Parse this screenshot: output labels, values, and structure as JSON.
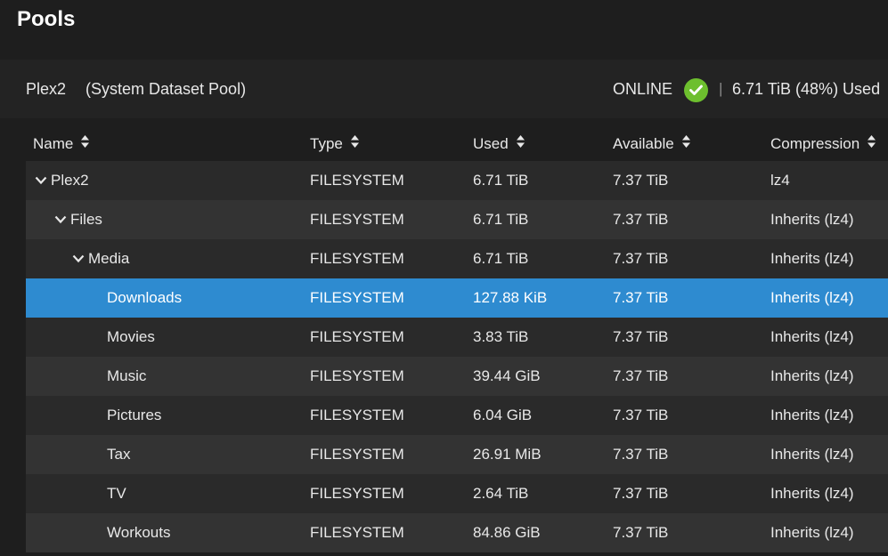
{
  "page": {
    "title": "Pools"
  },
  "pool": {
    "name": "Plex2",
    "description": "(System Dataset Pool)",
    "status": "ONLINE",
    "separator": "|",
    "usage": "6.71 TiB (48%) Used"
  },
  "columns": [
    "Name",
    "Type",
    "Used",
    "Available",
    "Compression"
  ],
  "rows": [
    {
      "name": "Plex2",
      "type": "FILESYSTEM",
      "used": "6.71 TiB",
      "available": "7.37 TiB",
      "compression": "lz4"
    },
    {
      "name": "Files",
      "type": "FILESYSTEM",
      "used": "6.71 TiB",
      "available": "7.37 TiB",
      "compression": "Inherits (lz4)"
    },
    {
      "name": "Media",
      "type": "FILESYSTEM",
      "used": "6.71 TiB",
      "available": "7.37 TiB",
      "compression": "Inherits (lz4)"
    },
    {
      "name": "Downloads",
      "type": "FILESYSTEM",
      "used": "127.88 KiB",
      "available": "7.37 TiB",
      "compression": "Inherits (lz4)"
    },
    {
      "name": "Movies",
      "type": "FILESYSTEM",
      "used": "3.83 TiB",
      "available": "7.37 TiB",
      "compression": "Inherits (lz4)"
    },
    {
      "name": "Music",
      "type": "FILESYSTEM",
      "used": "39.44 GiB",
      "available": "7.37 TiB",
      "compression": "Inherits (lz4)"
    },
    {
      "name": "Pictures",
      "type": "FILESYSTEM",
      "used": "6.04 GiB",
      "available": "7.37 TiB",
      "compression": "Inherits (lz4)"
    },
    {
      "name": "Tax",
      "type": "FILESYSTEM",
      "used": "26.91 MiB",
      "available": "7.37 TiB",
      "compression": "Inherits (lz4)"
    },
    {
      "name": "TV",
      "type": "FILESYSTEM",
      "used": "2.64 TiB",
      "available": "7.37 TiB",
      "compression": "Inherits (lz4)"
    },
    {
      "name": "Workouts",
      "type": "FILESYSTEM",
      "used": "84.86 GiB",
      "available": "7.37 TiB",
      "compression": "Inherits (lz4)"
    }
  ],
  "icons": {
    "status": "check-circle-icon",
    "sort": "sort-icon",
    "expand": "chevron-down-icon"
  },
  "colors": {
    "selected_row": "#2e8bd0",
    "status_ok": "#6dbf2e"
  }
}
